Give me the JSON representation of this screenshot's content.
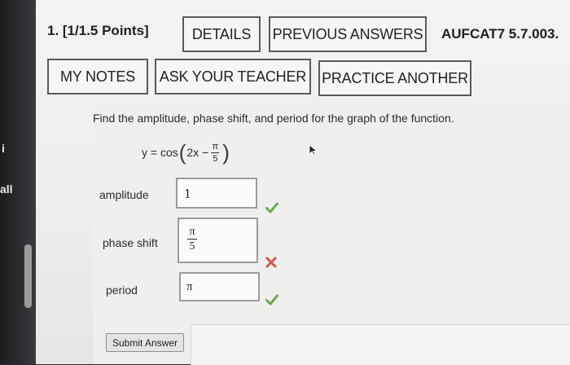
{
  "edge": {
    "text_top": "i",
    "text_mid": "all"
  },
  "question": {
    "number_label": "1. [1/1.5 Points]",
    "code": "AUFCAT7 5.7.003."
  },
  "buttons": {
    "details": "DETAILS",
    "previous_answers": "PREVIOUS ANSWERS",
    "my_notes": "MY NOTES",
    "ask_teacher": "ASK YOUR TEACHER",
    "practice_another": "PRACTICE ANOTHER"
  },
  "problem": {
    "prompt": "Find the amplitude, phase shift, and period for the graph of the function.",
    "eq_lhs": "y = cos",
    "eq_inner": "2x −",
    "eq_num": "π",
    "eq_den": "5",
    "paren_open": "(",
    "paren_close": ")"
  },
  "fields": {
    "amplitude": {
      "label": "amplitude",
      "value": "1",
      "status": "correct"
    },
    "phase_shift": {
      "label": "phase shift",
      "num": "π",
      "den": "5",
      "status": "incorrect"
    },
    "period": {
      "label": "period",
      "value": "π",
      "status": "correct"
    }
  },
  "submit_label": "Submit Answer",
  "colors": {
    "correct": "#6aa84f",
    "incorrect": "#d9534f",
    "button_border": "#5a5a5a"
  }
}
